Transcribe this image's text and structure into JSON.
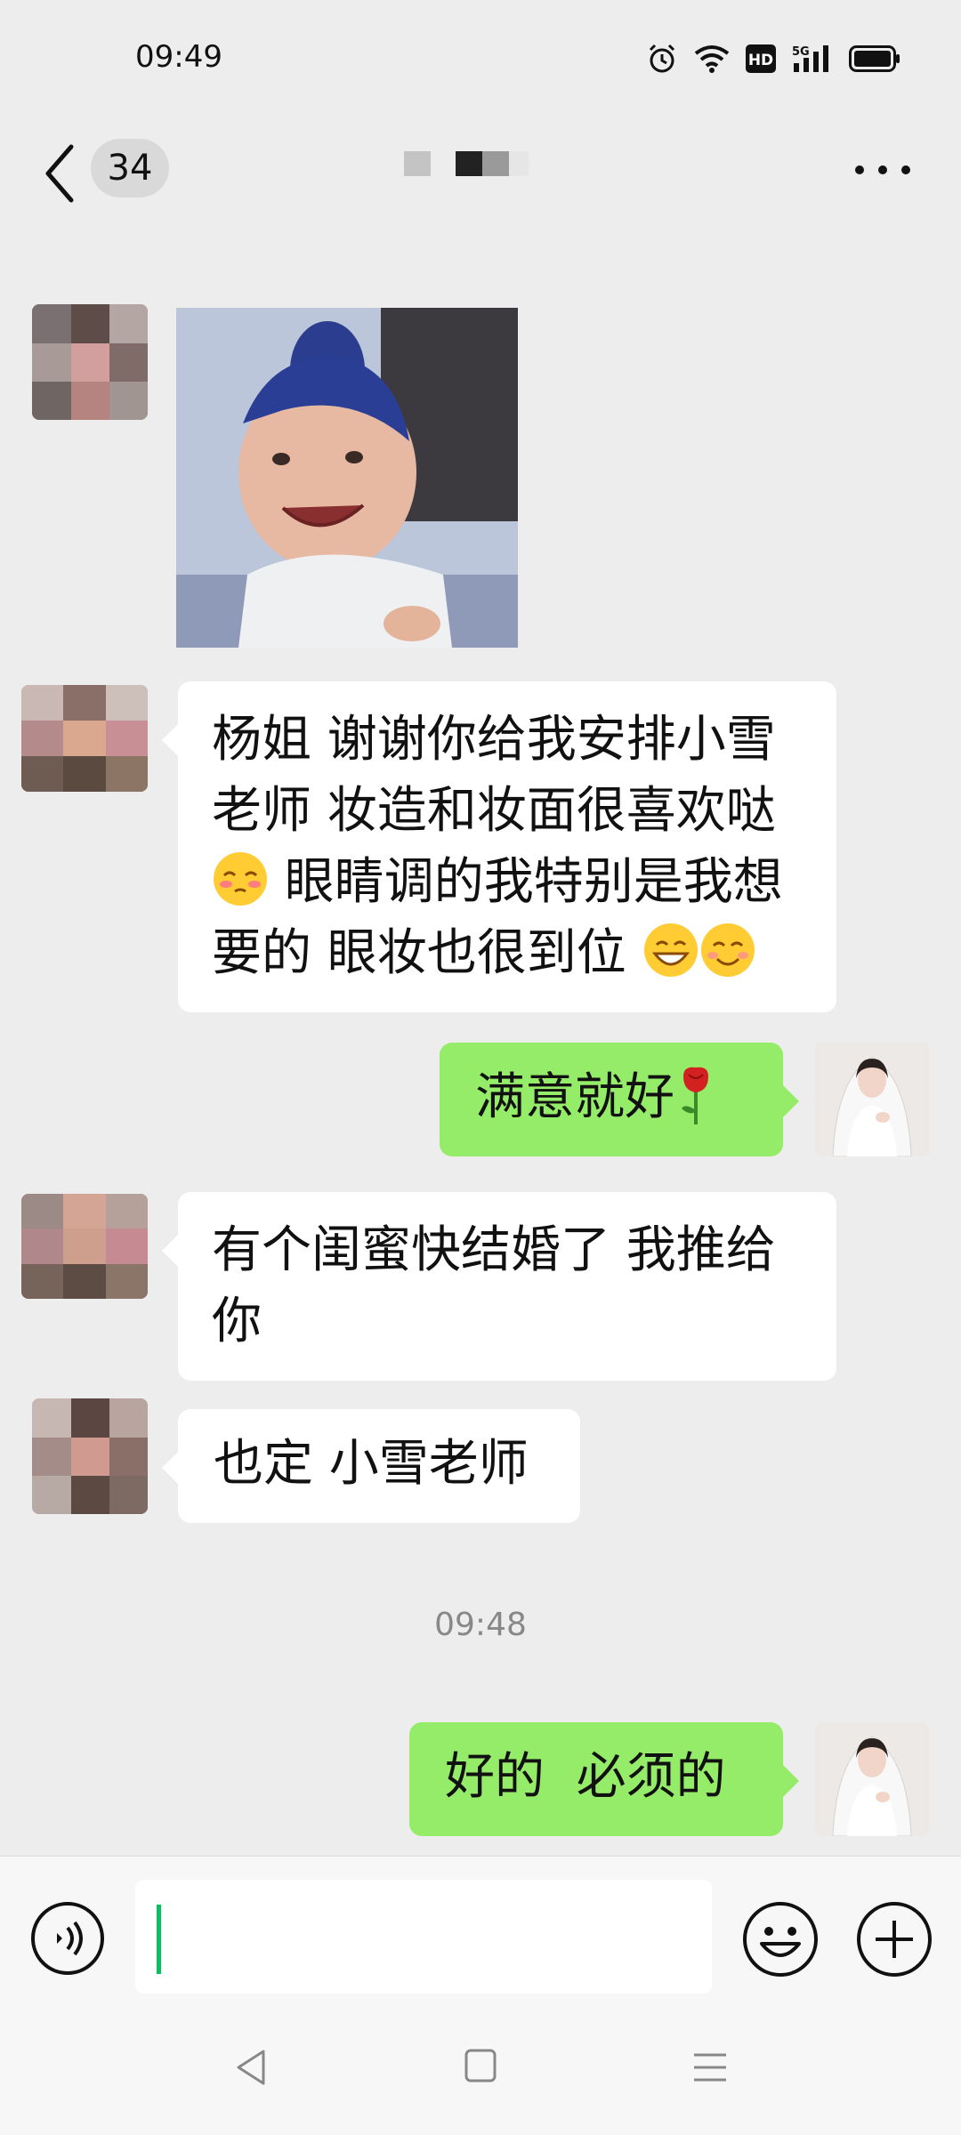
{
  "status_bar": {
    "time": "09:49",
    "network": "5G",
    "hd_label": "HD",
    "icons": [
      "alarm-icon",
      "wifi-icon",
      "hd-icon",
      "signal-5g-icon",
      "battery-icon"
    ]
  },
  "header": {
    "unread_count": "34",
    "title": "",
    "icons": [
      "back-chevron-icon",
      "more-dots-icon"
    ]
  },
  "messages": [
    {
      "type": "image",
      "side": "in",
      "content": "photo of a smiling child"
    },
    {
      "type": "text",
      "side": "in",
      "text_parts": [
        "杨姐 谢谢你给我安排小雪老师 妆造和妆面很喜欢哒",
        " 眼睛调的我特别是我想要的 眼妆也很到位 "
      ],
      "emojis": [
        "shy-emoji",
        "grin-emoji",
        "smile-emoji"
      ]
    },
    {
      "type": "text",
      "side": "out",
      "text": "满意就好",
      "emojis": [
        "rose-emoji"
      ]
    },
    {
      "type": "text",
      "side": "in",
      "text": "有个闺蜜快结婚了 我推给你"
    },
    {
      "type": "text",
      "side": "in",
      "text": "也定 小雪老师"
    },
    {
      "type": "timestamp",
      "text": "09:48"
    },
    {
      "type": "text",
      "side": "out",
      "text": "好的  必须的"
    }
  ],
  "input_bar": {
    "value": "",
    "icons": [
      "voice-icon",
      "emoji-icon",
      "plus-icon"
    ]
  },
  "nav_bar": {
    "icons": [
      "nav-back-icon",
      "nav-home-icon",
      "nav-menu-icon"
    ]
  },
  "colors": {
    "background": "#ededed",
    "outgoing_bubble": "#95ec69",
    "incoming_bubble": "#ffffff",
    "caret": "#07c160"
  }
}
